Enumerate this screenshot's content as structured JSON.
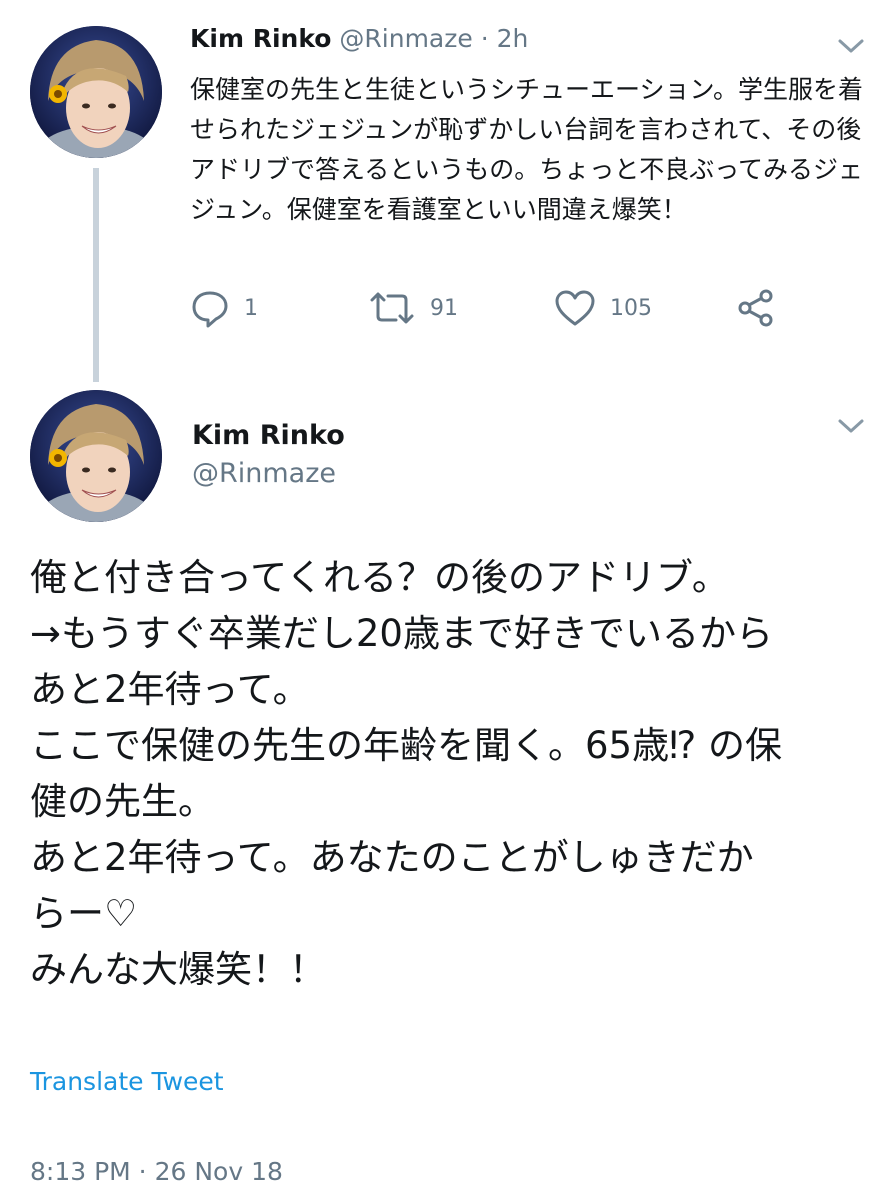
{
  "first_tweet": {
    "author_name": "Kim Rinko",
    "author_handle": "@Rinmaze",
    "separator": "·",
    "time_ago": "2h",
    "text": "保健室の先生と生徒というシチューエーション。学生服を着せられたジェジュンが恥ずかしい台詞を言わされて、その後アドリブで答えるというもの。ちょっと不良ぶってみるジェジュン。保健室を看護室といい間違え爆笑！",
    "actions": {
      "replies": "1",
      "retweets": "91",
      "likes": "105"
    }
  },
  "main_tweet": {
    "author_name": "Kim Rinko",
    "author_handle": "@Rinmaze",
    "lines": [
      "俺と付き合ってくれる？の後のアドリブ。",
      "→もうすぐ卒業だし20歳まで好きでいるから",
      "あと2年待って。",
      "ここで保健の先生の年齢を聞く。65歳⁉ の保",
      "健の先生。",
      "あと2年待って。あなたのことがしゅきだか",
      "らー♡",
      "みんな大爆笑！！"
    ],
    "translate_label": "Translate Tweet",
    "timestamp": "8:13 PM · 26 Nov 18"
  },
  "colors": {
    "text": "#14171a",
    "secondary": "#657786",
    "link": "#1b95e0",
    "thread_line": "#c8d2db"
  },
  "icons": {
    "reply": "reply-icon",
    "retweet": "retweet-icon",
    "like": "heart-icon",
    "share": "share-icon",
    "menu": "chevron-down-icon"
  }
}
